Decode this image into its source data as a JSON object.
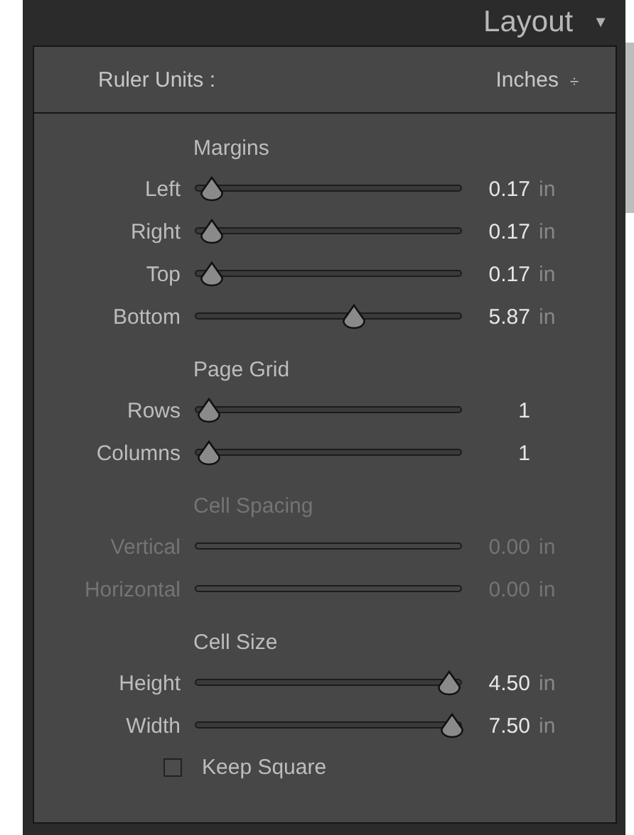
{
  "panel": {
    "title": "Layout",
    "collapse_icon": "▼"
  },
  "ruler_units": {
    "label": "Ruler Units :",
    "value": "Inches",
    "stepper_icon": "÷"
  },
  "sections": [
    {
      "title": "Margins",
      "disabled": false,
      "sliders": [
        {
          "label": "Left",
          "level": 0.06,
          "value": "0.17",
          "unit": "in"
        },
        {
          "label": "Right",
          "level": 0.06,
          "value": "0.17",
          "unit": "in"
        },
        {
          "label": "Top",
          "level": 0.06,
          "value": "0.17",
          "unit": "in"
        },
        {
          "label": "Bottom",
          "level": 0.54,
          "value": "5.87",
          "unit": "in"
        }
      ]
    },
    {
      "title": "Page Grid",
      "disabled": false,
      "sliders": [
        {
          "label": "Rows",
          "level": 0.05,
          "value": "1"
        },
        {
          "label": "Columns",
          "level": 0.05,
          "value": "1"
        }
      ]
    },
    {
      "title": "Cell Spacing",
      "disabled": true,
      "sliders": [
        {
          "label": "Vertical",
          "value": "0.00",
          "unit": "in"
        },
        {
          "label": "Horizontal",
          "value": "0.00",
          "unit": "in"
        }
      ]
    },
    {
      "title": "Cell Size",
      "disabled": false,
      "sliders": [
        {
          "label": "Height",
          "level": 0.86,
          "value": "4.50",
          "unit": "in"
        },
        {
          "label": "Width",
          "level": 0.87,
          "value": "7.50",
          "unit": "in"
        }
      ]
    }
  ],
  "keep_square": {
    "label": "Keep Square",
    "checked": false
  }
}
